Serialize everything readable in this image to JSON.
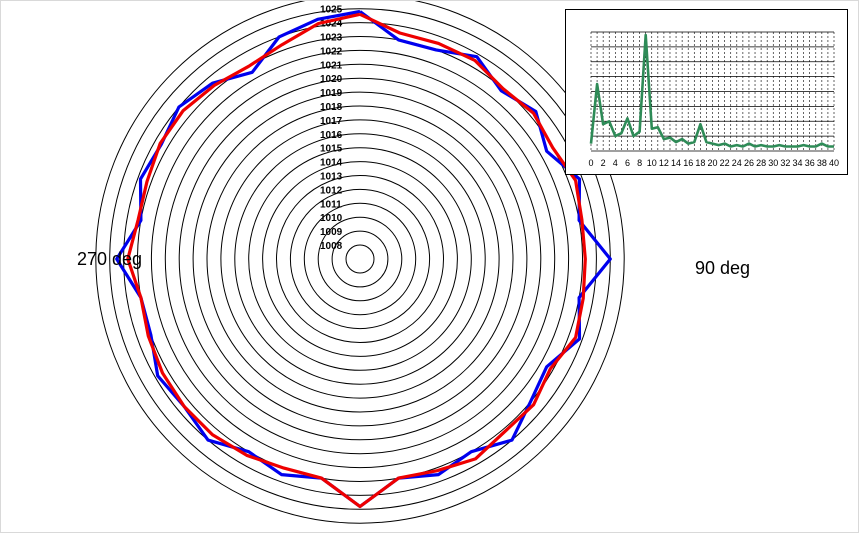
{
  "chart_data": [
    {
      "type": "polar-line",
      "radial_axis": {
        "min": 1007,
        "max": 1026,
        "tick_labels": [
          "1008",
          "1009",
          "1010",
          "1011",
          "1012",
          "1013",
          "1014",
          "1015",
          "1016",
          "1017",
          "1018",
          "1019",
          "1020",
          "1021",
          "1022",
          "1023",
          "1024",
          "1025",
          "1026"
        ]
      },
      "direction_labels": {
        "west": "270 deg",
        "east": "90 deg"
      },
      "angles_deg": [
        0,
        10,
        20,
        30,
        40,
        50,
        60,
        70,
        80,
        90,
        100,
        110,
        120,
        130,
        140,
        150,
        160,
        170,
        180,
        190,
        200,
        210,
        220,
        230,
        240,
        250,
        260,
        270,
        280,
        290,
        300,
        310,
        320,
        330,
        340,
        350
      ],
      "series": [
        {
          "color": "#0000ee",
          "values": [
            1024.8,
            1023.0,
            1023.0,
            1023.8,
            1022.8,
            1023.5,
            1022.5,
            1023.8,
            1023.0,
            1025.0,
            1023.0,
            1023.8,
            1022.5,
            1023.0,
            1024.0,
            1023.0,
            1023.5,
            1023.0,
            1024.8,
            1023.0,
            1023.5,
            1023.0,
            1024.0,
            1023.5,
            1023.8,
            1023.0,
            1023.0,
            1024.5,
            1023.0,
            1023.8,
            1023.5,
            1024.0,
            1023.5,
            1022.5,
            1024.0,
            1024.5
          ]
        },
        {
          "color": "#ee0000",
          "values": [
            1024.6,
            1023.5,
            1023.5,
            1023.5,
            1023.0,
            1023.3,
            1023.0,
            1023.5,
            1023.2,
            1023.2,
            1023.3,
            1023.5,
            1022.8,
            1023.3,
            1023.2,
            1023.6,
            1023.2,
            1023.0,
            1024.8,
            1023.0,
            1023.0,
            1023.3,
            1023.5,
            1023.5,
            1023.4,
            1023.2,
            1023.0,
            1023.7,
            1023.2,
            1023.3,
            1023.6,
            1023.6,
            1023.3,
            1023.0,
            1023.4,
            1024.2
          ]
        }
      ]
    },
    {
      "type": "line",
      "x_tick_labels": [
        "0",
        "2",
        "4",
        "6",
        "8",
        "10",
        "12",
        "14",
        "16",
        "18",
        "20",
        "22",
        "24",
        "26",
        "28",
        "30",
        "32",
        "34",
        "36",
        "38",
        "40"
      ],
      "x": [
        0,
        1,
        2,
        3,
        4,
        5,
        6,
        7,
        8,
        9,
        10,
        11,
        12,
        13,
        14,
        15,
        16,
        17,
        18,
        19,
        20,
        21,
        22,
        23,
        24,
        25,
        26,
        27,
        28,
        29,
        30,
        31,
        32,
        33,
        34,
        35,
        36,
        37,
        38,
        39,
        40
      ],
      "ylim": [
        0,
        8
      ],
      "series": [
        {
          "color": "#2e8b57",
          "values": [
            0.5,
            4.5,
            1.8,
            2.0,
            1.0,
            1.2,
            2.2,
            1.0,
            1.3,
            7.8,
            1.5,
            1.6,
            0.8,
            0.9,
            0.6,
            0.8,
            0.5,
            0.6,
            1.8,
            0.6,
            0.5,
            0.4,
            0.5,
            0.3,
            0.4,
            0.3,
            0.5,
            0.3,
            0.4,
            0.3,
            0.3,
            0.4,
            0.3,
            0.3,
            0.3,
            0.4,
            0.3,
            0.3,
            0.5,
            0.3,
            0.3
          ]
        }
      ]
    }
  ]
}
